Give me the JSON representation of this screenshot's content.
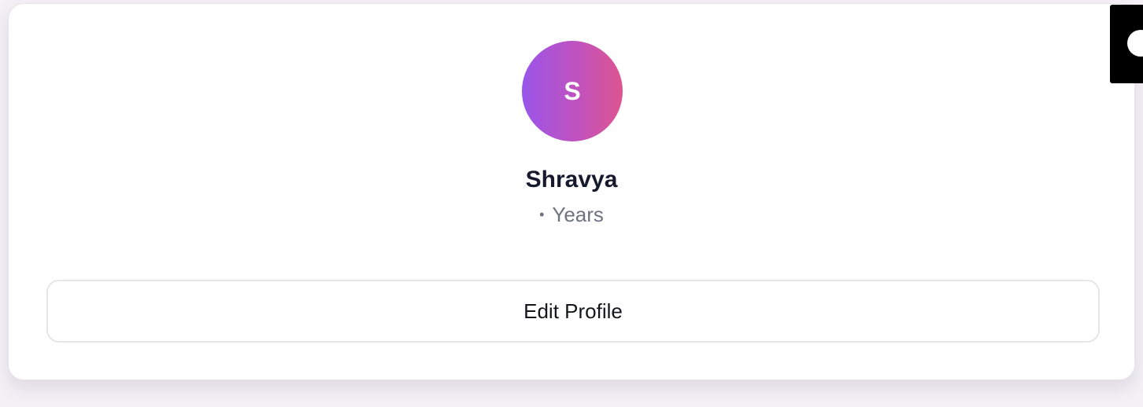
{
  "profile": {
    "avatar_initial": "S",
    "name": "Shravya",
    "separator": "•",
    "age_label": "Years",
    "edit_button_label": "Edit Profile"
  },
  "colors": {
    "avatar_gradient_start": "#9a55ea",
    "avatar_gradient_end": "#dd5590",
    "name_text": "#161a2c",
    "secondary_text": "#6e7380",
    "card_background": "#ffffff",
    "page_background": "#f4f1f6"
  },
  "icons": {
    "corner_widget": "circle-icon"
  }
}
